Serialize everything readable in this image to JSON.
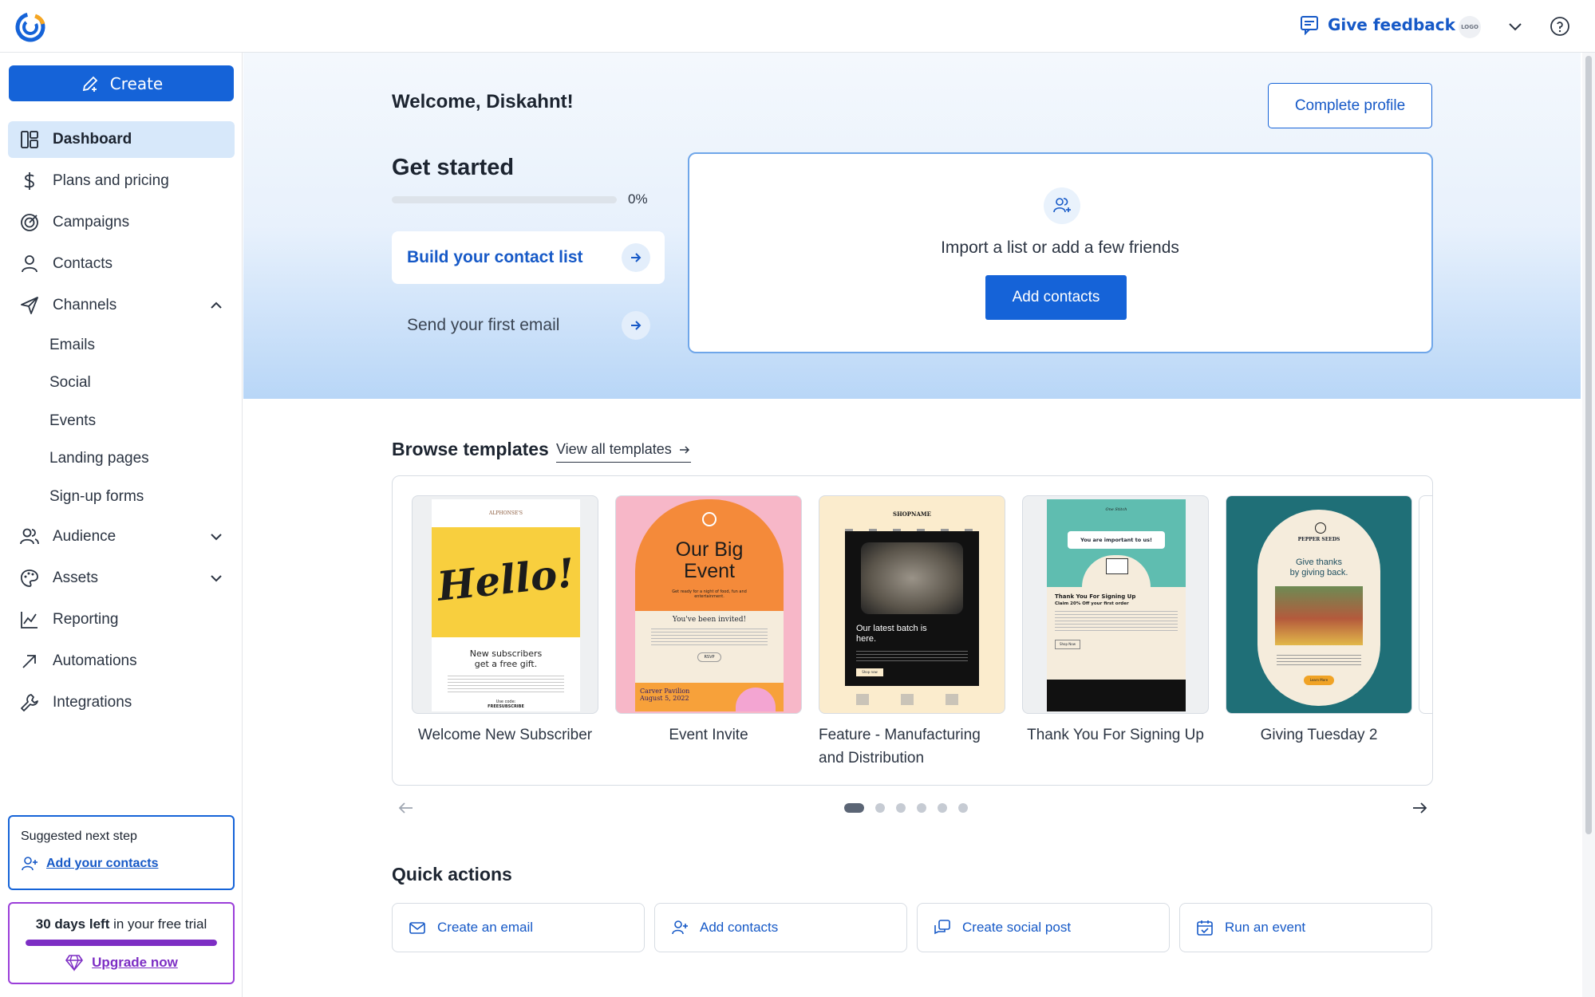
{
  "topbar": {
    "feedback_label": "Give feedback",
    "avatar_text": "LOGO"
  },
  "sidebar": {
    "create_label": "Create",
    "items": [
      {
        "label": "Dashboard",
        "icon": "dashboard-icon",
        "active": true
      },
      {
        "label": "Plans and pricing",
        "icon": "dollar-icon"
      },
      {
        "label": "Campaigns",
        "icon": "target-icon"
      },
      {
        "label": "Contacts",
        "icon": "person-icon"
      },
      {
        "label": "Channels",
        "icon": "send-icon",
        "expanded": true
      }
    ],
    "channel_subitems": [
      "Emails",
      "Social",
      "Events",
      "Landing pages",
      "Sign-up forms"
    ],
    "items_after": [
      {
        "label": "Audience",
        "icon": "people-icon"
      },
      {
        "label": "Assets",
        "icon": "palette-icon"
      },
      {
        "label": "Reporting",
        "icon": "chart-icon"
      },
      {
        "label": "Automations",
        "icon": "arrow-up-right-icon"
      },
      {
        "label": "Integrations",
        "icon": "wrench-icon"
      }
    ],
    "suggest": {
      "title": "Suggested next step",
      "link": "Add your contacts"
    },
    "trial": {
      "days_bold": "30 days left",
      "rest": " in your free trial",
      "progress": 1.0,
      "upgrade": "Upgrade now"
    }
  },
  "main": {
    "welcome": "Welcome, Diskahnt!",
    "complete_profile": "Complete profile",
    "get_started": {
      "title": "Get started",
      "progress_percent": 0,
      "progress_label": "0%",
      "steps": [
        "Build your contact list",
        "Send your first email"
      ]
    },
    "import_card": {
      "text": "Import a list or add a few friends",
      "button": "Add contacts"
    },
    "browse": {
      "title": "Browse templates",
      "view_all": "View all templates",
      "templates": [
        {
          "name": "Welcome New Subscriber",
          "thumb": {
            "brand": "ALPHONSE'S",
            "headline": "Hello!",
            "sub1": "New subscribers",
            "sub2": "get a free gift.",
            "code_label": "Use code:",
            "code": "FREESUBSCRIBE"
          }
        },
        {
          "name": "Event Invite",
          "thumb": {
            "title1": "Our Big",
            "title2": "Event",
            "tagline": "Get ready for a night of food, fun and entertainment.",
            "invited": "You've been invited!",
            "rsvp": "RSVP",
            "venue": "Carver Pavilion",
            "date": "August 5, 2022"
          }
        },
        {
          "name": "Feature - Manufacturing and Distribution",
          "thumb": {
            "brand": "SHOPNAME",
            "headline1": "Our latest batch is",
            "headline2": "here.",
            "cta": "Shop now"
          }
        },
        {
          "name": "Thank You For Signing Up",
          "thumb": {
            "brand": "One Stitch",
            "banner": "You are important to us!",
            "headline": "Thank You For Signing Up",
            "offer": "Claim 20% Off your first order",
            "cta": "Shop Now"
          }
        },
        {
          "name": "Giving Tuesday 2",
          "thumb": {
            "brand": "PEPPER SEEDS",
            "headline1": "Give thanks",
            "headline2": "by giving back.",
            "cta": "Learn More"
          }
        }
      ],
      "dots": 6,
      "active_dot": 0
    },
    "quick_actions": {
      "title": "Quick actions",
      "items": [
        {
          "label": "Create an email",
          "icon": "mail-icon"
        },
        {
          "label": "Add contacts",
          "icon": "add-person-icon"
        },
        {
          "label": "Create social post",
          "icon": "social-post-icon"
        },
        {
          "label": "Run an event",
          "icon": "calendar-icon"
        }
      ]
    }
  },
  "colors": {
    "primary": "#1563d8",
    "link": "#1659c7",
    "trial_purple": "#7d2ec4",
    "active_nav_bg": "#d7e8fa"
  }
}
